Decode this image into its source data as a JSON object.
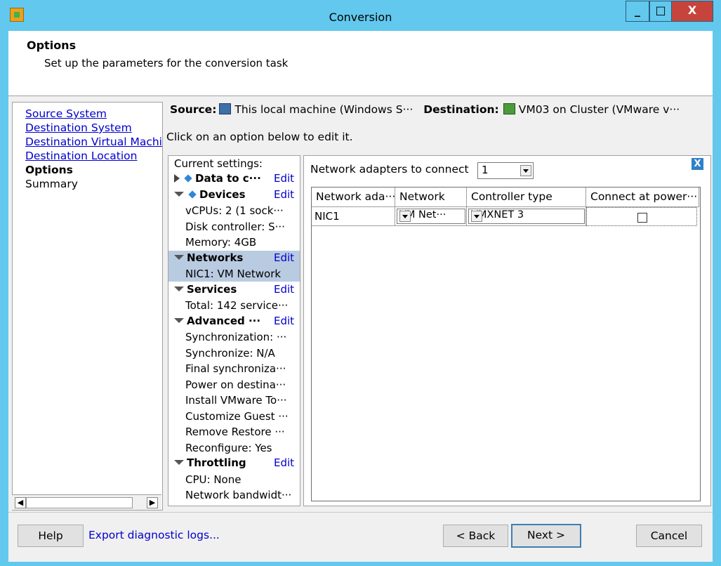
{
  "window": {
    "title": "Conversion",
    "minimize": "_",
    "maximize": "□",
    "close": "X"
  },
  "header": {
    "title": "Options",
    "subtitle": "Set up the parameters for the conversion task"
  },
  "nav": {
    "items": [
      {
        "label": "Source System",
        "link": true
      },
      {
        "label": "Destination System",
        "link": true
      },
      {
        "label": "Destination Virtual Machi",
        "link": true
      },
      {
        "label": "Destination Location",
        "link": true
      },
      {
        "label": "Options",
        "link": false,
        "current": true
      },
      {
        "label": "Summary",
        "link": false
      }
    ]
  },
  "source_bar": {
    "source_label": "Source:",
    "source_value": "This local machine (Windows S···",
    "dest_label": "Destination:",
    "dest_value": "VM03 on Cluster (VMware v···"
  },
  "hint": "Click on an option below to edit it.",
  "settings": {
    "heading": "Current settings:",
    "edit_label": "Edit",
    "data_to_copy": "Data to c···",
    "devices": "Devices",
    "vcpus": "vCPUs: 2 (1 sock···",
    "disk_controller": "Disk controller: S···",
    "memory": "Memory: 4GB",
    "networks": "Networks",
    "nic1": "NIC1: VM Network",
    "services": "Services",
    "services_total": "Total: 142 service···",
    "advanced": "Advanced ···",
    "sync1": "Synchronization: ···",
    "sync2": "Synchronize: N/A",
    "final_sync": "Final synchroniza···",
    "power_on": "Power on destina···",
    "install_tools": "Install VMware To···",
    "customize": "Customize Guest ···",
    "remove_restore": "Remove Restore ···",
    "reconfigure": "Reconfigure: Yes",
    "throttling": "Throttling",
    "cpu": "CPU: None",
    "bandwidth": "Network bandwidt···"
  },
  "detail": {
    "close_icon": "X",
    "adapters_label": "Network adapters to connect",
    "adapters_value": "1",
    "columns": [
      "Network ada···",
      "Network",
      "Controller type",
      "Connect at power···"
    ],
    "rows": [
      {
        "adapter": "NIC1",
        "network": "VM Net···",
        "controller": "VMXNET 3",
        "connect": false
      }
    ]
  },
  "footer": {
    "help": "Help",
    "export_logs": "Export diagnostic logs...",
    "back": "< Back",
    "next": "Next >",
    "cancel": "Cancel"
  }
}
